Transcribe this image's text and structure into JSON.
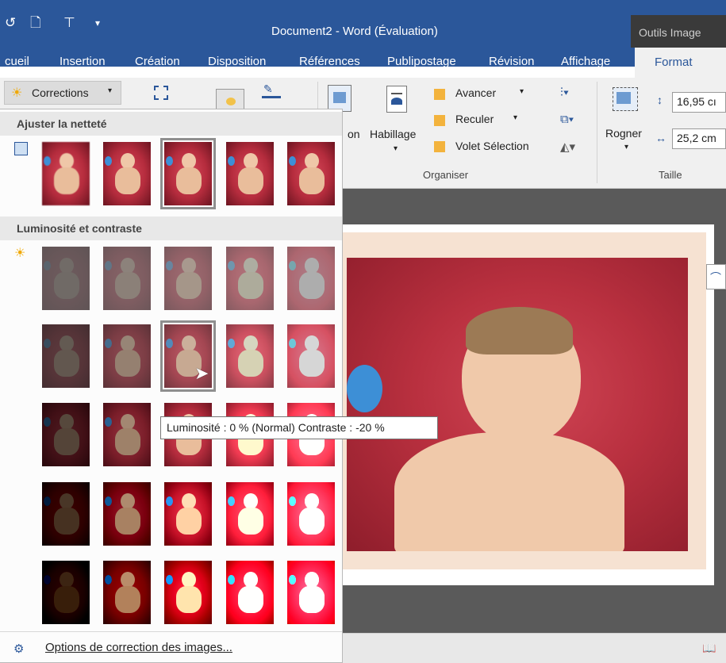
{
  "window": {
    "title": "Document2 - Word (Évaluation)",
    "context_tab_group": "Outils Image"
  },
  "quick_access": {
    "icons": [
      "undo-icon",
      "new-document-icon",
      "touch-mode-icon",
      "customize-dropdown-icon"
    ]
  },
  "tabs": [
    {
      "label": "cueil",
      "key": "accueil"
    },
    {
      "label": "Insertion",
      "key": "insertion"
    },
    {
      "label": "Création",
      "key": "creation"
    },
    {
      "label": "Disposition",
      "key": "disposition"
    },
    {
      "label": "Références",
      "key": "references"
    },
    {
      "label": "Publipostage",
      "key": "publipostage"
    },
    {
      "label": "Révision",
      "key": "revision"
    },
    {
      "label": "Affichage",
      "key": "affichage"
    },
    {
      "label": "Format",
      "key": "format",
      "active": true
    }
  ],
  "ribbon": {
    "corrections": "Corrections",
    "organiser": {
      "label": "Organiser",
      "position_fragment": "on",
      "habillage": "Habillage",
      "avancer": "Avancer",
      "reculer": "Reculer",
      "volet": "Volet Sélection"
    },
    "taille": {
      "label": "Taille",
      "rogner": "Rogner",
      "height": "16,95 cı",
      "width": "25,2 cm"
    }
  },
  "gallery": {
    "sharpness_header": "Ajuster la netteté",
    "brightness_header": "Luminosité et contraste",
    "options": "Options de correction des images...",
    "tooltip": "Luminosité : 0 % (Normal) Contraste : -20 %",
    "sharpness_presets": [
      0,
      1,
      2,
      3,
      4
    ],
    "sharpness_selected_index": 2,
    "brightness_values": [
      -0.4,
      -0.2,
      0,
      0.2,
      0.4
    ],
    "contrast_values": [
      -0.4,
      -0.2,
      0,
      0.2,
      0.4
    ],
    "hovered": {
      "brightness": 0,
      "contrast": -0.2
    }
  },
  "colors": {
    "word_blue": "#2b579a",
    "ribbon_bg": "#f0f0f0",
    "photo_red": "#c0303f",
    "frame_peach": "#f6e2d2"
  }
}
